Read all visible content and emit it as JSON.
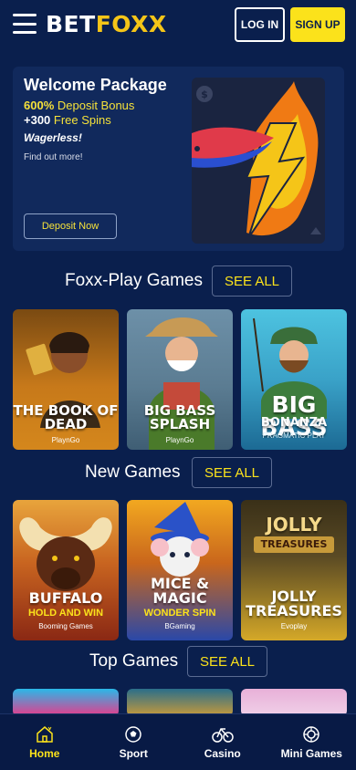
{
  "header": {
    "logo_bet": "BET",
    "logo_foxx": "FOXX",
    "login_label": "LOG IN",
    "signup_label": "SIGN UP"
  },
  "promo": {
    "title": "Welcome Package",
    "line1_bold": "600%",
    "line1_rest": " Deposit Bonus",
    "line2_bold": "+300",
    "line2_rest": " Free Spins",
    "line3": "Wagerless!",
    "line4": "Find out more!",
    "deposit_label": "Deposit Now"
  },
  "sections": [
    {
      "title": "Foxx-Play Games",
      "see_all": "SEE ALL",
      "games": [
        {
          "title1": "THE BOOK OF",
          "title2": "DEAD",
          "provider": "PlaynGo"
        },
        {
          "title1": "BIG BASS",
          "title2": "SPLASH",
          "provider": "PlaynGo"
        },
        {
          "title1": "BIG BASS",
          "title2": "BONANZA",
          "provider": "PRAGMATIC PLAY"
        }
      ]
    },
    {
      "title": "New Games",
      "see_all": "SEE ALL",
      "games": [
        {
          "title1": "BUFFALO",
          "accent": "HOLD AND WIN",
          "provider": "Booming Games"
        },
        {
          "title1": "MICE &",
          "title2": "MAGIC",
          "accent": "WONDER SPIN",
          "provider": "BGaming"
        },
        {
          "title1": "JOLLY",
          "title2": "TREASURES",
          "logo1": "JOLLY",
          "logo2": "TREASURES",
          "provider": "Evoplay"
        }
      ]
    },
    {
      "title": "Top Games",
      "see_all": "SEE ALL"
    }
  ],
  "nav": [
    {
      "label": "Home",
      "icon": "home-icon",
      "active": true
    },
    {
      "label": "Sport",
      "icon": "soccer-ball-icon",
      "active": false
    },
    {
      "label": "Casino",
      "icon": "casino-icon",
      "active": false
    },
    {
      "label": "Mini Games",
      "icon": "mini-games-icon",
      "active": false
    }
  ],
  "colors": {
    "background": "#0a1f4d",
    "accent_yellow": "#fbe21b",
    "nav_background": "#081a45"
  }
}
